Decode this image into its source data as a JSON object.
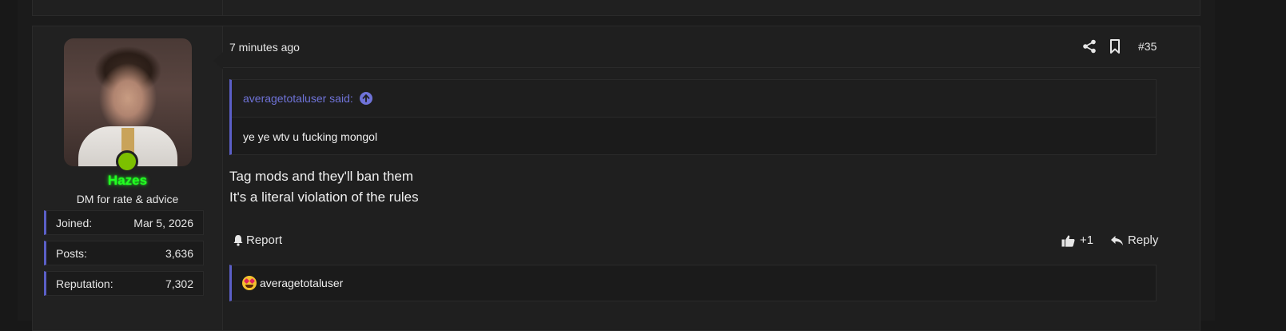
{
  "post": {
    "date": "7 minutes ago",
    "number": "#35",
    "user": {
      "name": "Hazes",
      "title": "DM for rate & advice",
      "stats": [
        {
          "label": "Joined:",
          "value": "Mar 5, 2026"
        },
        {
          "label": "Posts:",
          "value": "3,636"
        },
        {
          "label": "Reputation:",
          "value": "7,302"
        }
      ]
    },
    "quote": {
      "author": "averagetotaluser said:",
      "text": "ye ye wtv u fucking mongol"
    },
    "message": {
      "line1": "Tag mods and they'll ban them",
      "line2": "It's a literal violation of the rules"
    },
    "actions": {
      "report": "Report",
      "like_count": "+1",
      "reply": "Reply"
    },
    "reactions": {
      "users": "averagetotaluser"
    }
  },
  "colors": {
    "accent": "#5b5fc7",
    "username": "#22ff22",
    "online": "#7cc000"
  }
}
